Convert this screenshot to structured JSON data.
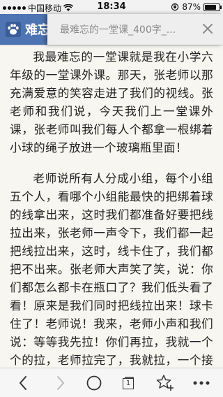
{
  "status_bar": {
    "carrier": "中国移动",
    "time": "18:34",
    "battery": "87%",
    "battery_level": 0.87
  },
  "header": {
    "site_title": "难忘",
    "page_title": "最难忘的一堂课_400字_..."
  },
  "article": {
    "paragraphs": [
      "我最难忘的一堂课就是我在小学六年级的一堂课外课。那天，张老师以那充满爱意的笑容走进了我们的视线。张老师和我们说，今天我们上一堂课外课，张老师叫我们每人个都拿一根绑着小球的绳子放进一个玻璃瓶里面！",
      "老师说所有人分成小组，每个小组五个人，看哪个小组能最快的把绑着球的线拿出来，这时我们都准备好要把线拉出来，张老师一声令下，我们都一起把线拉出来，这时，线卡住了，我们都把不出来。张老师大声笑了笑，说：你们都怎么都卡在瓶口了？我们低头看了看！原来是我们同时把线拉出来！球卡住了！老师说！我来，老师小声和我们说：等等我先拉！你们再拉，我就一个个的拉，老师拉完了，我就拉，一个接一个的拉，很快的都把线拉出来了，老"
    ]
  },
  "toolbar": {
    "tab_count": "1"
  }
}
